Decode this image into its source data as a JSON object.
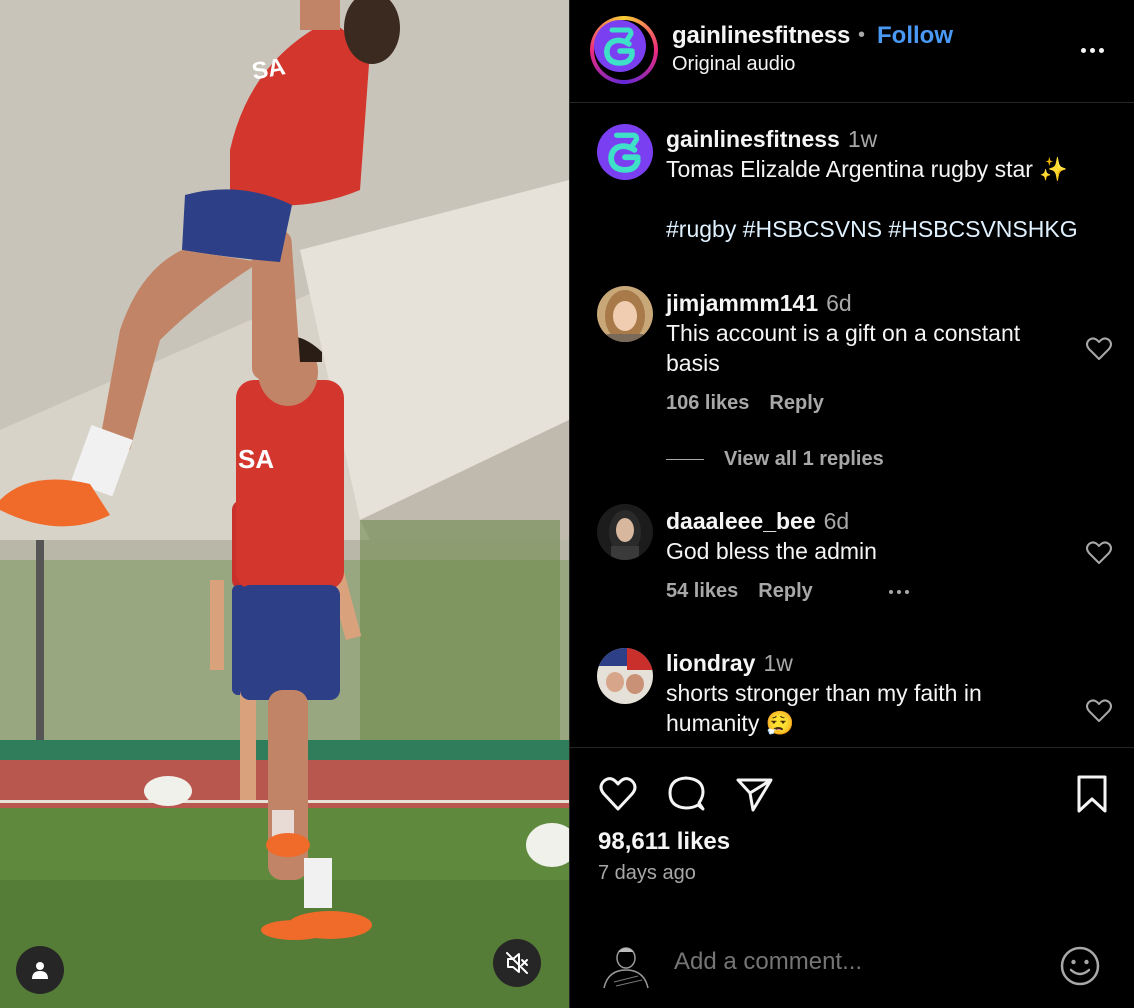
{
  "post": {
    "username": "gainlinesfitness",
    "separator": "•",
    "follow_label": "Follow",
    "audio_label": "Original audio"
  },
  "caption": {
    "username": "gainlinesfitness",
    "time": "1w",
    "text": "Tomas Elizalde Argentina rugby star ✨",
    "hashtags": "#rugby #HSBCSVNS #HSBCSVNSHKG"
  },
  "comments": [
    {
      "username": "jimjammm141",
      "time": "6d",
      "text": "This account is a gift on a constant basis",
      "likes": "106 likes",
      "reply": "Reply"
    },
    {
      "username": "daaaleee_bee",
      "time": "6d",
      "text": "God bless the admin",
      "likes": "54 likes",
      "reply": "Reply"
    },
    {
      "username": "liondray",
      "time": "1w",
      "text": "shorts stronger than my faith in humanity 😮‍💨"
    }
  ],
  "view_replies": "View all 1 replies",
  "stats": {
    "likes": "98,611 likes",
    "posted": "7 days ago"
  },
  "composer": {
    "placeholder": "Add a comment..."
  },
  "icons": {
    "like": "heart-icon",
    "comment": "comment-bubble-icon",
    "share": "paper-plane-icon",
    "save": "bookmark-icon",
    "more": "more-horizontal-icon",
    "emoji": "emoji-smile-icon",
    "user": "user-tag-icon",
    "mute": "speaker-muted-icon"
  },
  "colors": {
    "follow": "#4a9af5",
    "brand": "#7b3ff2",
    "brand_mark": "#3ee0c8"
  }
}
